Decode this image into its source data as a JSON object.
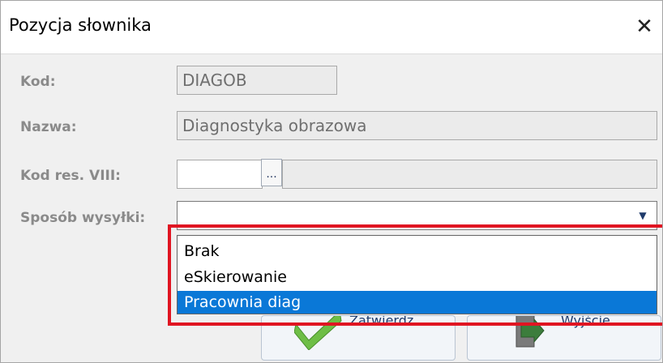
{
  "window": {
    "title": "Pozycja słownika",
    "close_glyph": "✕"
  },
  "form": {
    "kod": {
      "label": "Kod:",
      "value": "DIAGOB"
    },
    "nazwa": {
      "label": "Nazwa:",
      "value": "Diagnostyka obrazowa"
    },
    "kod_res": {
      "label": "Kod res. VIII:",
      "value": "",
      "button": "..."
    },
    "sposob": {
      "label": "Sposób wysyłki:",
      "value": ""
    }
  },
  "dropdown": {
    "options": [
      "Brak",
      "eSkierowanie",
      "Pracownia diag"
    ],
    "selected_index": 2
  },
  "buttons": {
    "confirm_label": "Zatwierdz",
    "exit_label": "Wyjście"
  },
  "colors": {
    "selection": "#0a78d7",
    "highlight": "#e01522",
    "confirm_icon": "#6ebe46",
    "exit_icon": "#3c7d3c"
  }
}
